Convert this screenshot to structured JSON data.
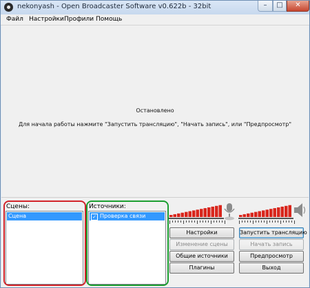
{
  "window": {
    "title": "nekonyash - Open Broadcaster Software v0.622b - 32bit"
  },
  "menu": {
    "items": [
      "Файл",
      "Настройки",
      "Профили",
      "Помощь"
    ],
    "underline": [
      "Ф",
      "Н",
      "П",
      "П"
    ]
  },
  "preview": {
    "status": "Остановлено",
    "hint": "Для начала работы нажмите \"Запустить трансляцию\", \"Начать запись\", или \"Предпросмотр\""
  },
  "scenes": {
    "label": "Сцены:",
    "items": [
      "Сцена"
    ]
  },
  "sources": {
    "label": "Источники:",
    "items": [
      {
        "label": "Проверка связи",
        "checked": true
      }
    ]
  },
  "buttons": {
    "settings": "Настройки",
    "start_stream": "Запустить трансляцию",
    "edit_scene": "Изменение сцены",
    "start_record": "Начать запись",
    "global_sources": "Общие источники",
    "preview": "Предпросмотр",
    "plugins": "Плагины",
    "exit": "Выход"
  },
  "icons": {
    "mic": "microphone-icon",
    "speaker": "speaker-icon",
    "app": "obs-app-icon"
  },
  "colors": {
    "scene_outline": "#d2232a",
    "source_outline": "#1b9e30",
    "meter_bar": "#d9261c",
    "selection": "#3399ff"
  }
}
